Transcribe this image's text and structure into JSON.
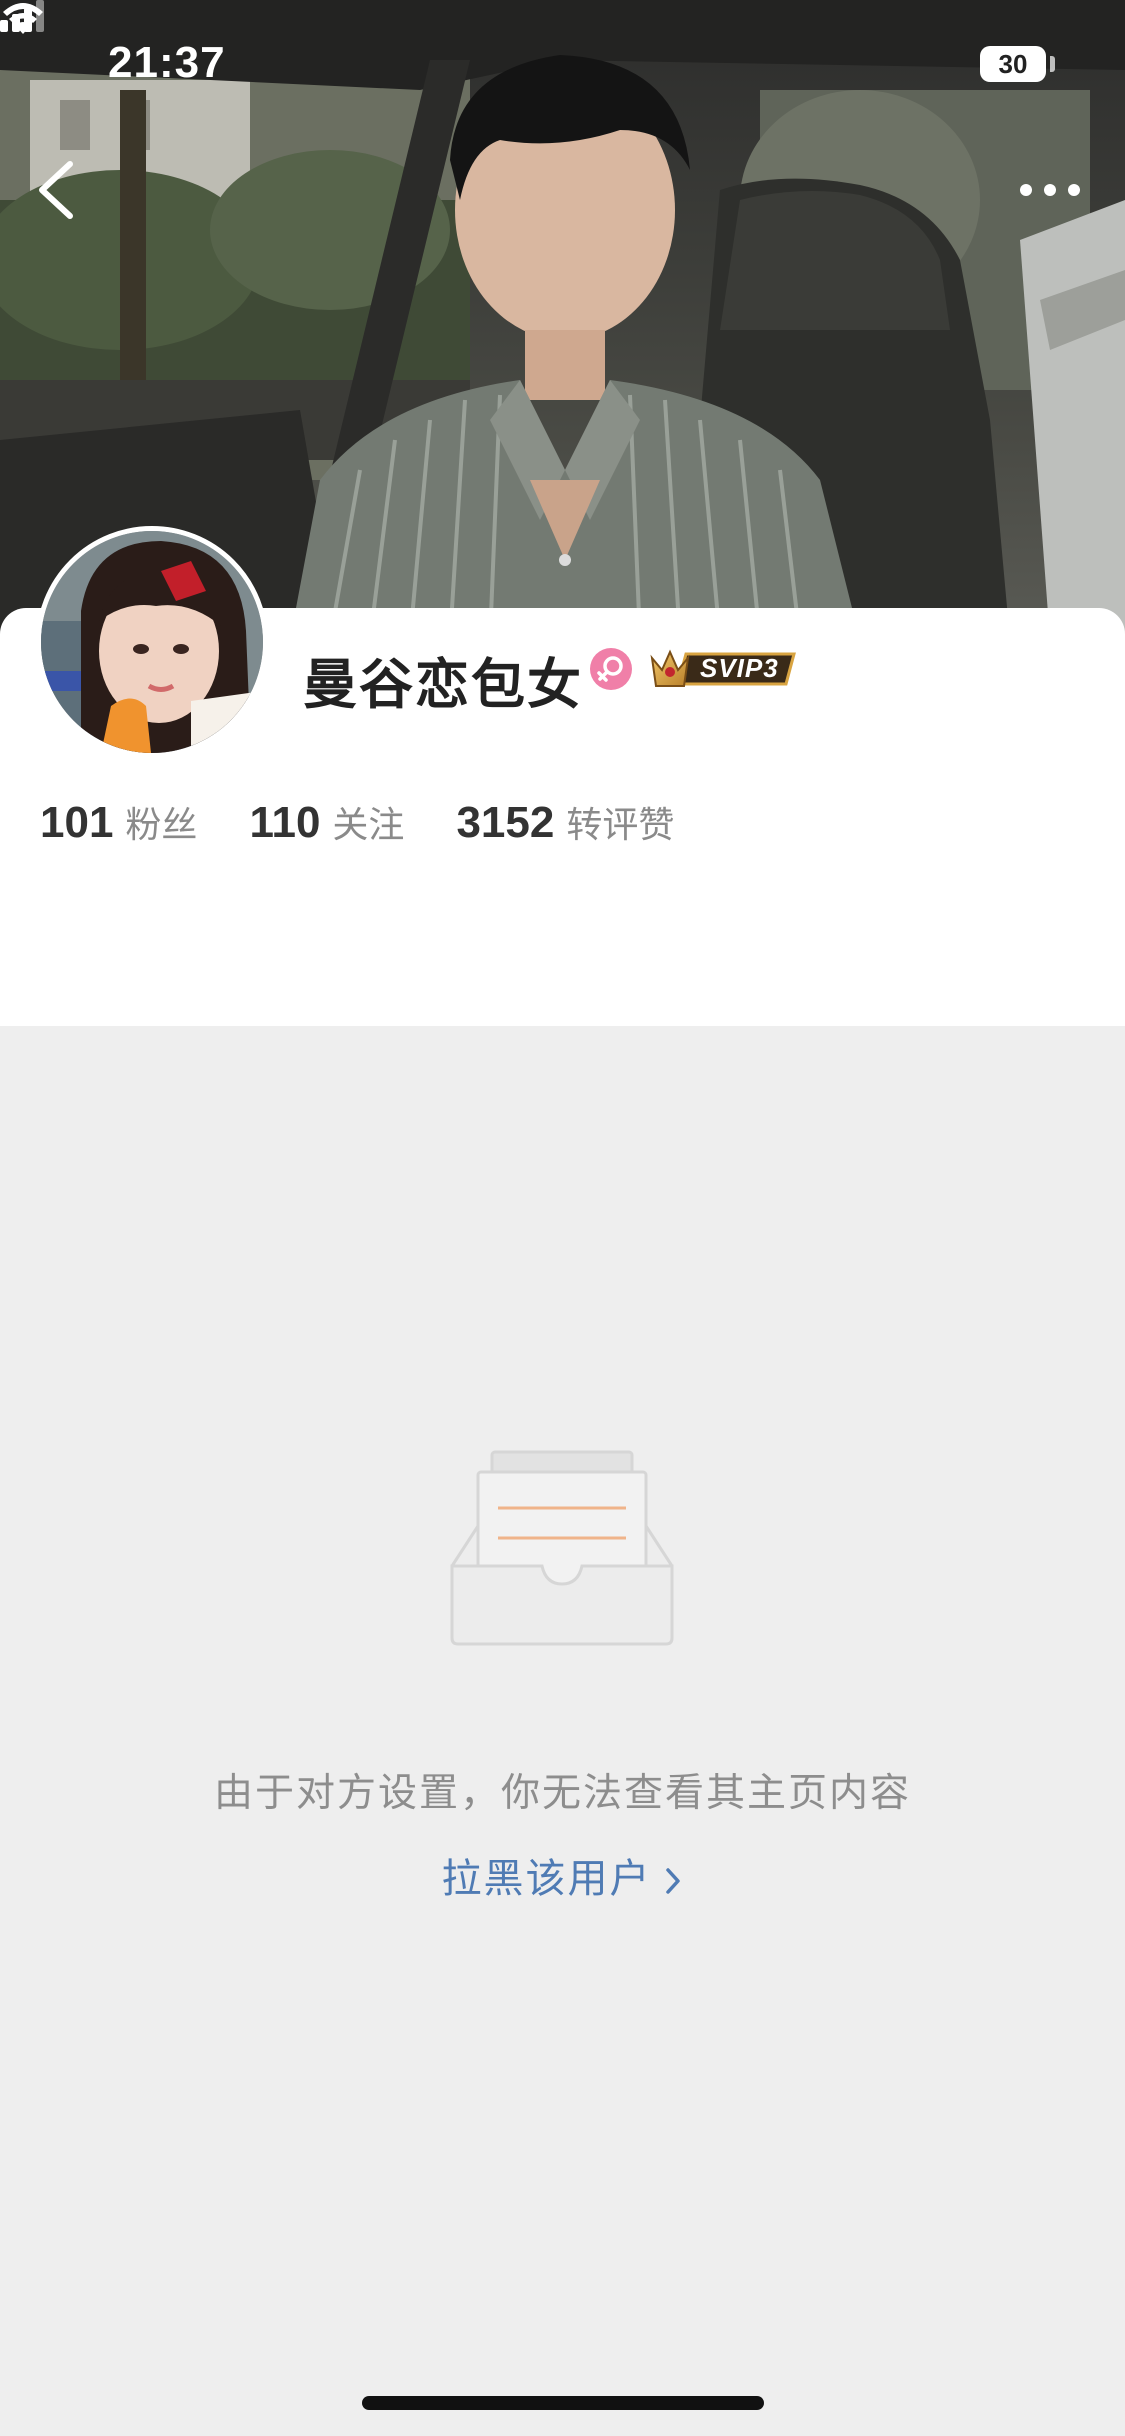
{
  "status_bar": {
    "time": "21:37",
    "battery": "30"
  },
  "profile": {
    "username": "曼谷恋包女",
    "vip_badge": "SVIP3",
    "stats": [
      {
        "value": "101",
        "label": "粉丝"
      },
      {
        "value": "110",
        "label": "关注"
      },
      {
        "value": "3152",
        "label": "转评赞"
      }
    ]
  },
  "empty_state": {
    "message": "由于对方设置，你无法查看其主页内容",
    "block_link": "拉黑该用户"
  },
  "colors": {
    "link": "#4f7bb4",
    "gender_badge": "#f07fa8",
    "svip_gold": "#d9a441",
    "background": "#eeeeee"
  },
  "icons": {
    "back": "chevron-left-icon",
    "more": "more-dots-icon",
    "gender": "female-icon",
    "link_chevron": "chevron-right-icon"
  }
}
